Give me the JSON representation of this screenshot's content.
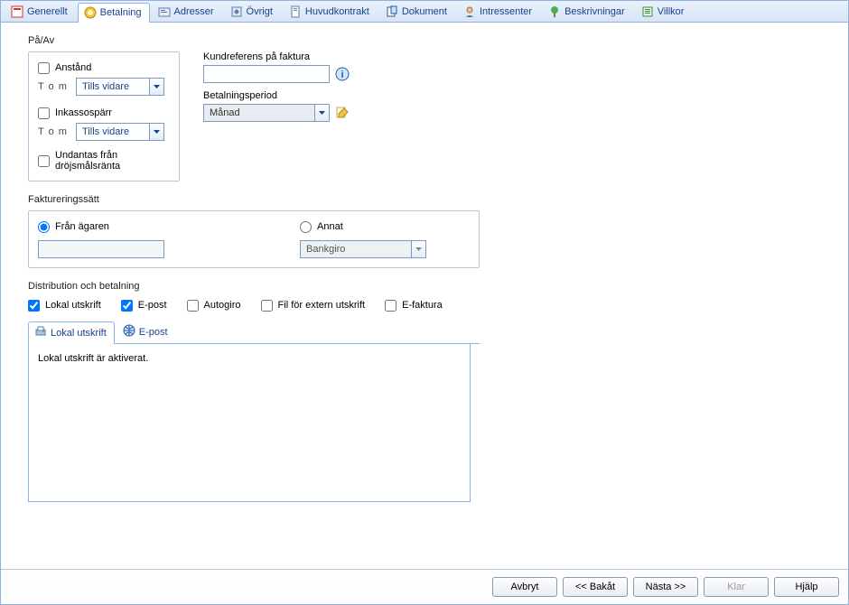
{
  "tabs": [
    {
      "label": "Generellt"
    },
    {
      "label": "Betalning"
    },
    {
      "label": "Adresser"
    },
    {
      "label": "Övrigt"
    },
    {
      "label": "Huvudkontrakt"
    },
    {
      "label": "Dokument"
    },
    {
      "label": "Intressenter"
    },
    {
      "label": "Beskrivningar"
    },
    {
      "label": "Villkor"
    }
  ],
  "section1": {
    "legend": "På/Av",
    "anstand_label": "Anstånd",
    "tom_label": "T o m",
    "anstand_tom_value": "Tills vidare",
    "inkasso_label": "Inkassospärr",
    "inkasso_tom_value": "Tills vidare",
    "undantas_label": "Undantas från dröjsmålsränta"
  },
  "kundref": {
    "label": "Kundreferens på faktura",
    "value": "",
    "period_label": "Betalningsperiod",
    "period_value": "Månad"
  },
  "fakt": {
    "legend": "Faktureringssätt",
    "fran_agaren_label": "Från ägaren",
    "annat_label": "Annat",
    "annat_value": "Bankgiro"
  },
  "dist": {
    "legend": "Distribution och betalning",
    "lokal_label": "Lokal utskrift",
    "epost_label": "E-post",
    "autogiro_label": "Autogiro",
    "fil_label": "Fil för extern utskrift",
    "efaktura_label": "E-faktura",
    "tab_lokal": "Lokal utskrift",
    "tab_epost": "E-post",
    "panel_text": "Lokal utskrift är aktiverat."
  },
  "buttons": {
    "avbryt": "Avbryt",
    "bakat": "<< Bakåt",
    "nasta": "Nästa >>",
    "klar": "Klar",
    "hjalp": "Hjälp"
  }
}
